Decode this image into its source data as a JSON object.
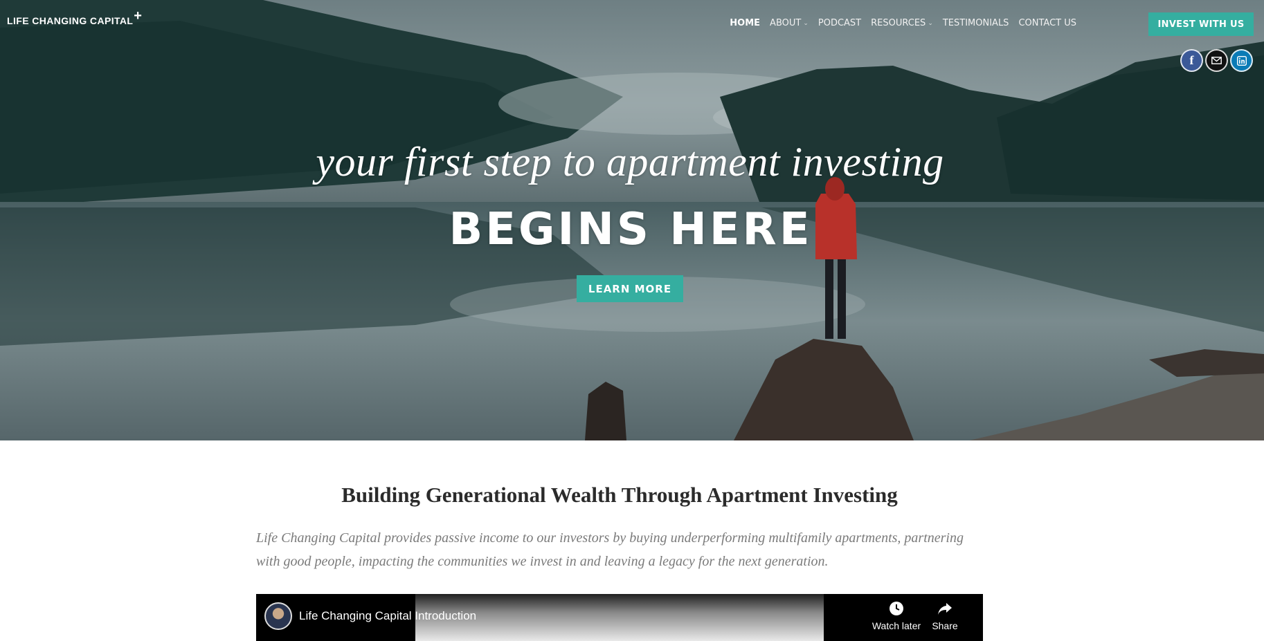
{
  "header": {
    "logo_text": "LIFE CHANGING CAPITAL",
    "logo_mark": "+",
    "nav": [
      {
        "label": "HOME",
        "active": true,
        "dropdown": false
      },
      {
        "label": "ABOUT",
        "active": false,
        "dropdown": true
      },
      {
        "label": "PODCAST",
        "active": false,
        "dropdown": false
      },
      {
        "label": "RESOURCES",
        "active": false,
        "dropdown": true
      },
      {
        "label": "TESTIMONIALS",
        "active": false,
        "dropdown": false
      },
      {
        "label": "CONTACT US",
        "active": false,
        "dropdown": false
      }
    ],
    "cta_label": "INVEST WITH US",
    "social_icons": [
      "facebook-icon",
      "mail-icon",
      "linkedin-icon"
    ]
  },
  "hero": {
    "tagline": "your first step to apartment investing",
    "headline": "BEGINS HERE",
    "button_label": "LEARN MORE"
  },
  "main": {
    "title": "Building Generational Wealth Through Apartment Investing",
    "intro": "Life Changing Capital provides passive income to our investors by buying underperforming multifamily apartments, partnering with good people, impacting the communities we invest in and leaving a legacy for the next generation."
  },
  "video": {
    "title": "Life Changing Capital Introduction",
    "watch_later": "Watch later",
    "share": "Share"
  },
  "colors": {
    "accent": "#35aea0",
    "facebook": "#3b5998",
    "linkedin": "#0a7bb6"
  }
}
